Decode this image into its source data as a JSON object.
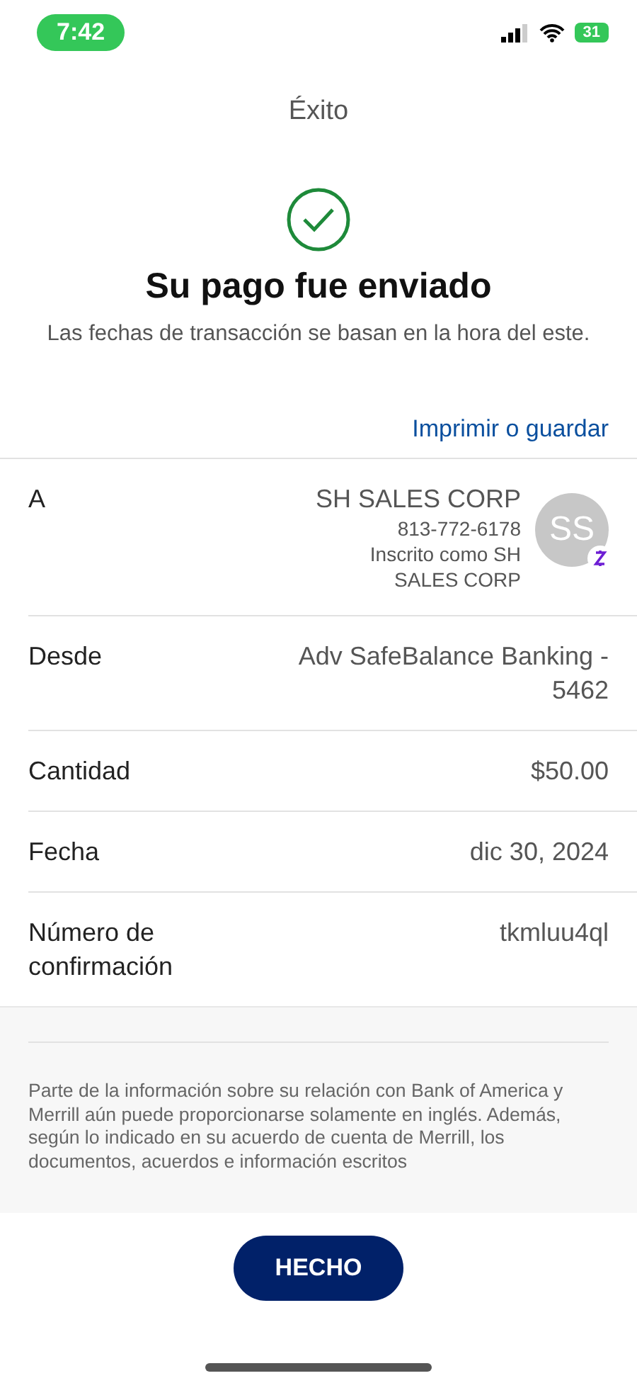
{
  "status_bar": {
    "time": "7:42",
    "battery": "31"
  },
  "header": {
    "title": "Éxito"
  },
  "result": {
    "heading": "Su pago fue enviado",
    "note": "Las fechas de transacción se basan en la hora del este."
  },
  "print_link": "Imprimir o guardar",
  "recipient": {
    "label": "A",
    "name": "SH SALES CORP",
    "phone": "813-772-6178",
    "enrolled": "Inscrito como SH SALES CORP",
    "initials": "SS"
  },
  "details": [
    {
      "label": "Desde",
      "value": "Adv SafeBalance Banking - 5462"
    },
    {
      "label": "Cantidad",
      "value": "$50.00"
    },
    {
      "label": "Fecha",
      "value": "dic 30, 2024"
    },
    {
      "label": "Número de confirmación",
      "value": "tkmluu4ql"
    }
  ],
  "disclaimer": "Parte de la información sobre su relación con Bank of America y Merrill aún puede proporcionarse solamente en inglés. Además, según lo indicado en su acuerdo de cuenta de Merrill, los documentos, acuerdos e información escritos",
  "done_button": "HECHO"
}
